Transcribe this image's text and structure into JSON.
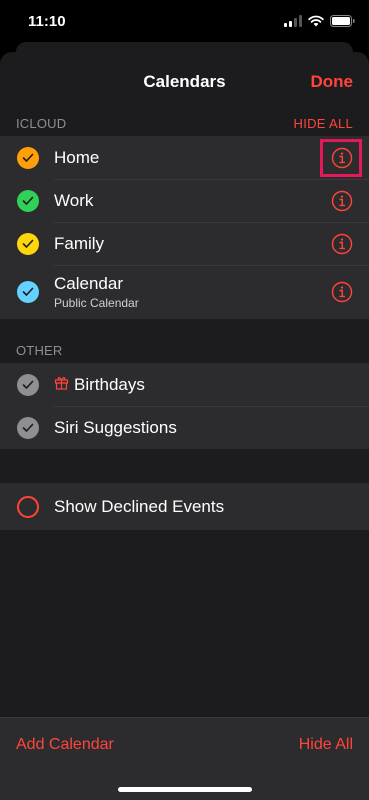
{
  "status": {
    "time": "11:10"
  },
  "nav": {
    "title": "Calendars",
    "done_label": "Done"
  },
  "icloud": {
    "header": "ICLOUD",
    "hide_all": "HIDE ALL",
    "items": [
      {
        "label": "Home",
        "color": "#ff9f0a",
        "checked": true
      },
      {
        "label": "Work",
        "color": "#30d158",
        "checked": true
      },
      {
        "label": "Family",
        "color": "#ffd60a",
        "checked": true
      },
      {
        "label": "Calendar",
        "sublabel": "Public Calendar",
        "color": "#64d2ff",
        "checked": true
      }
    ]
  },
  "other": {
    "header": "OTHER",
    "items": [
      {
        "label": "Birthdays",
        "icon": "gift-icon",
        "color": "#8e8e93",
        "checked": true
      },
      {
        "label": "Siri Suggestions",
        "color": "#8e8e93",
        "checked": true
      }
    ]
  },
  "declined": {
    "label": "Show Declined Events",
    "checked": false
  },
  "toolbar": {
    "add_label": "Add Calendar",
    "hide_label": "Hide All"
  },
  "colors": {
    "accent": "#ff453a",
    "highlight": "#e5195a"
  }
}
